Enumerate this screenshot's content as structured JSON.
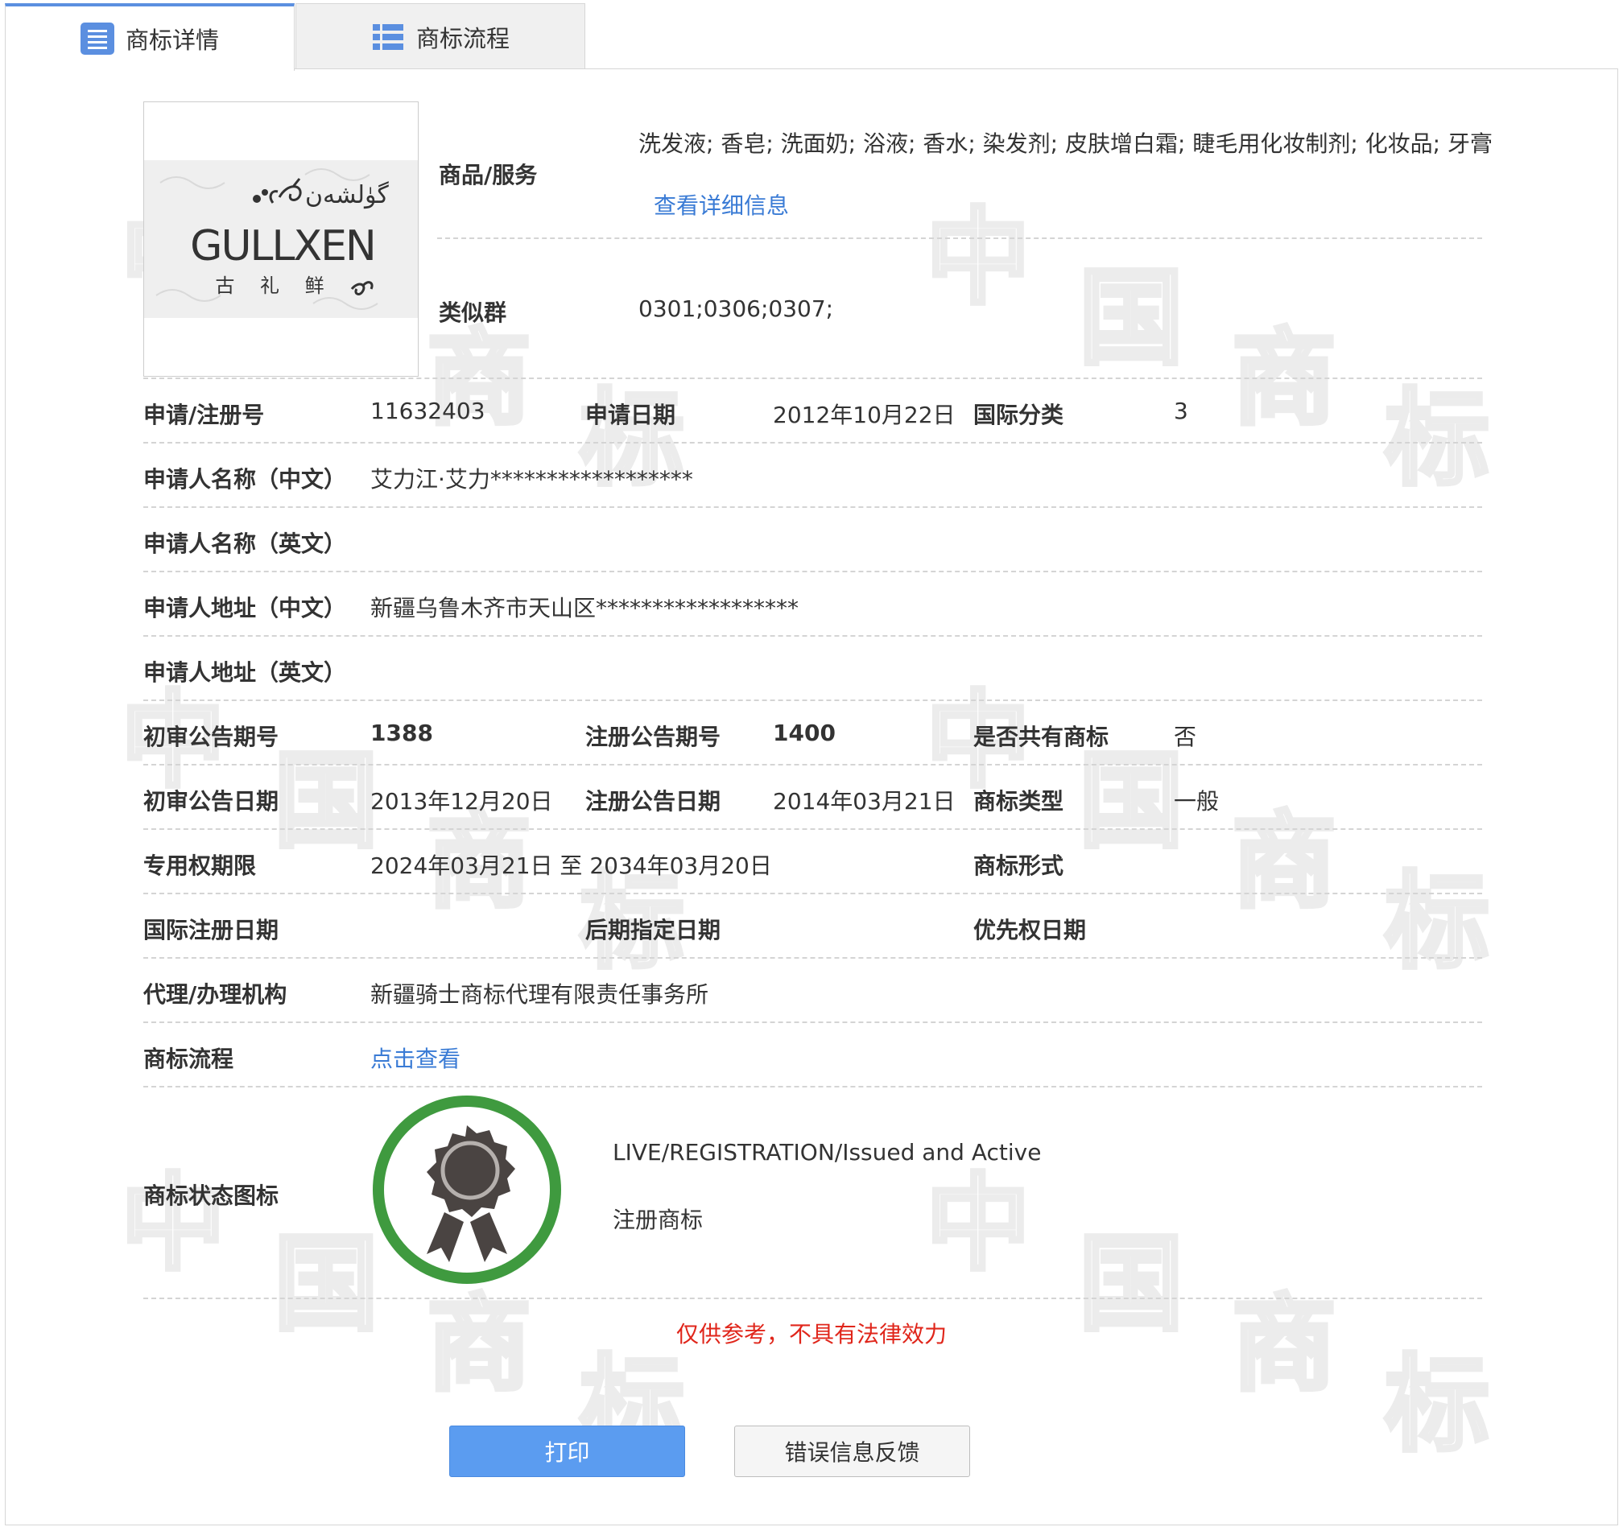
{
  "tabs": [
    {
      "label": "商标详情",
      "icon": "list-icon",
      "active": true
    },
    {
      "label": "商标流程",
      "icon": "table-icon",
      "active": false
    }
  ],
  "watermark_chars": [
    "中",
    "国",
    "商",
    "标"
  ],
  "logo": {
    "latin": "GULLXEN",
    "chinese": "古 礼 鲜",
    "arabic": "گۈلشەن"
  },
  "goods": {
    "label": "商品/服务",
    "value": "洗发液; 香皂; 洗面奶; 浴液; 香水; 染发剂; 皮肤增白霜; 睫毛用化妆制剂; 化妆品; 牙膏",
    "detail_link": "查看详细信息"
  },
  "similar_group": {
    "label": "类似群",
    "value": "0301;0306;0307;"
  },
  "rows": {
    "reg_no": {
      "label": "申请/注册号",
      "value": "11632403"
    },
    "app_date": {
      "label": "申请日期",
      "value": "2012年10月22日"
    },
    "intl_class": {
      "label": "国际分类",
      "value": "3"
    },
    "applicant_cn": {
      "label": "申请人名称（中文）",
      "value": "艾力江·艾力******************"
    },
    "applicant_en": {
      "label": "申请人名称（英文）",
      "value": ""
    },
    "address_cn": {
      "label": "申请人地址（中文）",
      "value": "新疆乌鲁木齐市天山区******************"
    },
    "address_en": {
      "label": "申请人地址（英文）",
      "value": ""
    },
    "prelim_issue": {
      "label": "初审公告期号",
      "value": "1388"
    },
    "reg_issue": {
      "label": "注册公告期号",
      "value": "1400"
    },
    "shared": {
      "label": "是否共有商标",
      "value": "否"
    },
    "prelim_date": {
      "label": "初审公告日期",
      "value": "2013年12月20日"
    },
    "reg_date": {
      "label": "注册公告日期",
      "value": "2014年03月21日"
    },
    "mark_type": {
      "label": "商标类型",
      "value": "一般"
    },
    "exclusive_period": {
      "label": "专用权期限",
      "value": "2024年03月21日 至 2034年03月20日"
    },
    "mark_form": {
      "label": "商标形式",
      "value": ""
    },
    "intl_reg_date": {
      "label": "国际注册日期",
      "value": ""
    },
    "later_date": {
      "label": "后期指定日期",
      "value": ""
    },
    "priority_date": {
      "label": "优先权日期",
      "value": ""
    },
    "agency": {
      "label": "代理/办理机构",
      "value": "新疆骑士商标代理有限责任事务所"
    },
    "process": {
      "label": "商标流程",
      "link": "点击查看"
    }
  },
  "status": {
    "label": "商标状态图标",
    "icon": "registered-seal-icon",
    "en": "LIVE/REGISTRATION/Issued and Active",
    "cn": "注册商标",
    "ring_color": "#3f9a3f"
  },
  "disclaimer": "仅供参考，不具有法律效力",
  "buttons": {
    "print": "打印",
    "feedback": "错误信息反馈"
  },
  "colors": {
    "accent": "#5b9cf0",
    "link": "#3a7bd5",
    "warning": "#e0261b"
  }
}
